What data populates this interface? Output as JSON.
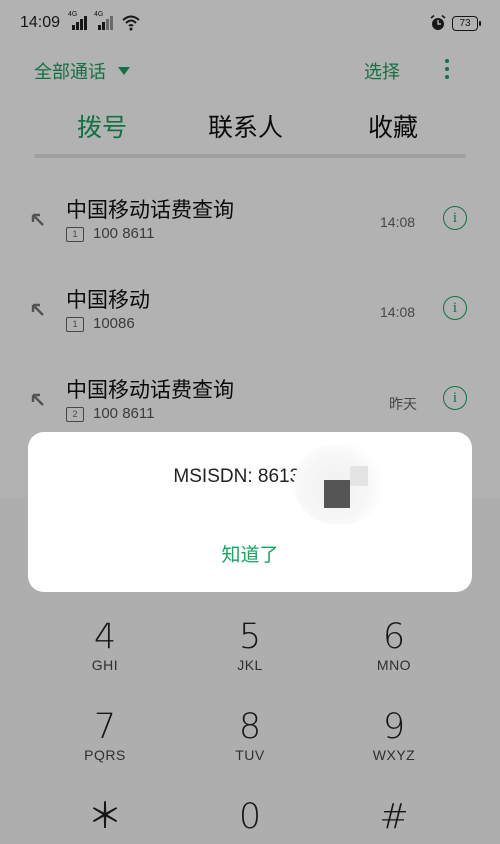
{
  "status_bar": {
    "time": "14:09",
    "network_1": "4G",
    "network_2": "4G",
    "battery": "73"
  },
  "topbar": {
    "filter_label": "全部通话",
    "select_label": "选择"
  },
  "tabs": [
    {
      "label": "拨号",
      "active": true
    },
    {
      "label": "联系人",
      "active": false
    },
    {
      "label": "收藏",
      "active": false
    }
  ],
  "calls": [
    {
      "name": "中国移动话费查询",
      "sim": "1",
      "number": "100 8611",
      "time": "14:08"
    },
    {
      "name": "中国移动",
      "sim": "1",
      "number": "10086",
      "time": "14:08"
    },
    {
      "name": "中国移动话费查询",
      "sim": "2",
      "number": "100 8611",
      "time": "昨天"
    }
  ],
  "dialpad": [
    {
      "digit": "4",
      "letters": "GHI"
    },
    {
      "digit": "5",
      "letters": "JKL"
    },
    {
      "digit": "6",
      "letters": "MNO"
    },
    {
      "digit": "7",
      "letters": "PQRS"
    },
    {
      "digit": "8",
      "letters": "TUV"
    },
    {
      "digit": "9",
      "letters": "WXYZ"
    },
    {
      "digit": "＊",
      "letters": ""
    },
    {
      "digit": "0",
      "letters": ""
    },
    {
      "digit": "#",
      "letters": ""
    }
  ],
  "dialog": {
    "message": "MSISDN: 8613      72",
    "ok_label": "知道了"
  },
  "colors": {
    "accent": "#1aa260",
    "overlay": "rgba(0,0,0,0.30)"
  }
}
